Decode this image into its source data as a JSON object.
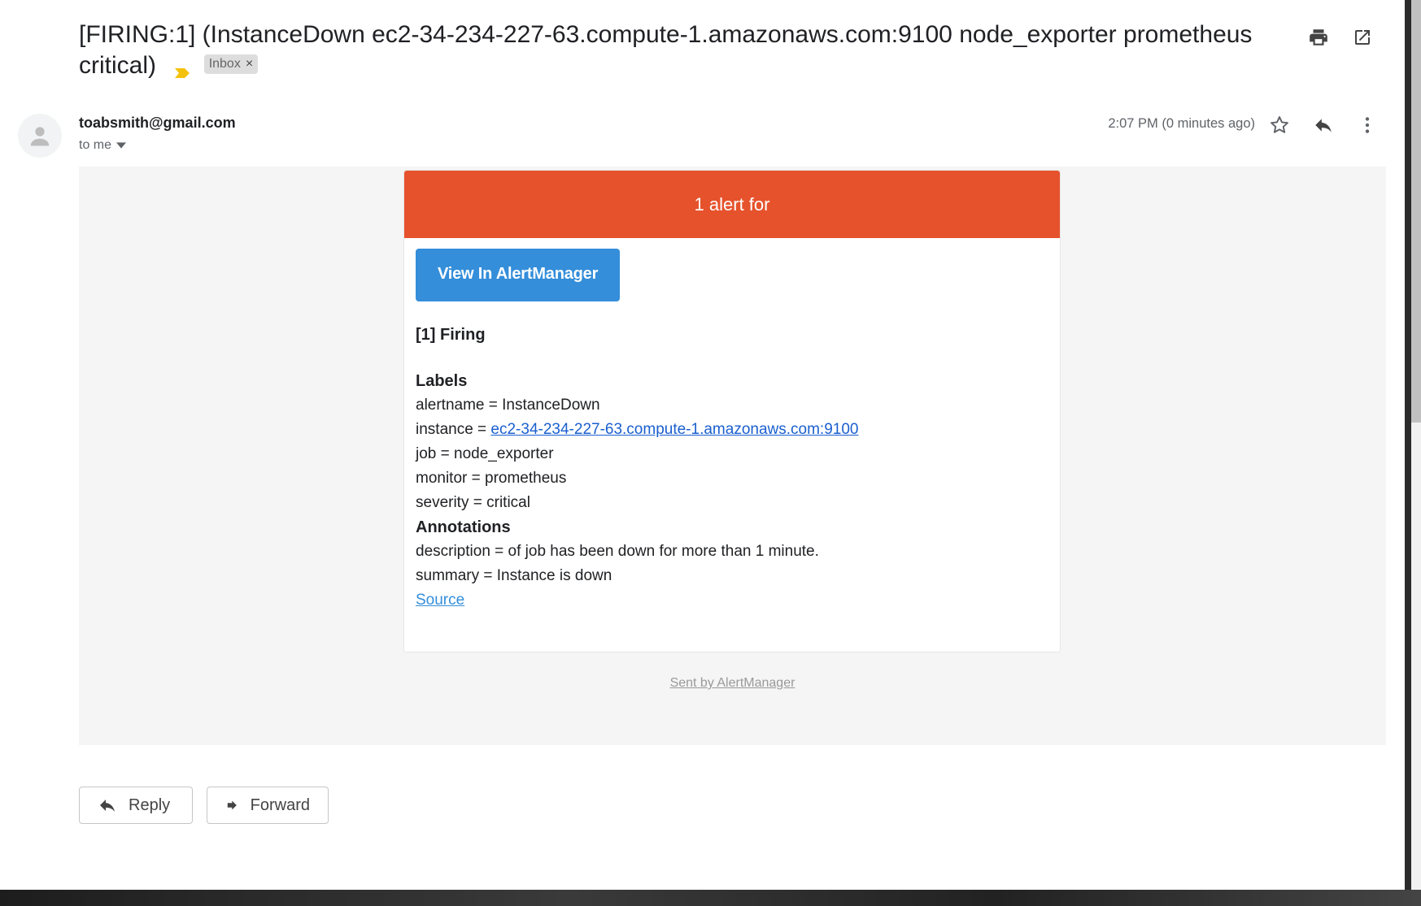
{
  "subject": {
    "text": "[FIRING:1] (InstanceDown ec2-34-234-227-63.compute-1.amazonaws.com:9100 node_exporter prometheus critical)",
    "label_chip": "Inbox",
    "label_chip_close": "×"
  },
  "message": {
    "sender": "toabsmith@gmail.com",
    "to": "to me",
    "time": "2:07 PM (0 minutes ago)"
  },
  "email": {
    "header": "1 alert for",
    "button": "View In AlertManager",
    "firing": "[1] Firing",
    "labels_title": "Labels",
    "labels": {
      "alertname": "alertname = InstanceDown",
      "instance_prefix": "instance = ",
      "instance_link": "ec2-34-234-227-63.compute-1.amazonaws.com:9100",
      "job": "job = node_exporter",
      "monitor": "monitor = prometheus",
      "severity": "severity = critical"
    },
    "annotations_title": "Annotations",
    "annotations": {
      "description": "description = of job has been down for more than 1 minute.",
      "summary": "summary = Instance is down"
    },
    "source": "Source",
    "footer": "Sent by AlertManager"
  },
  "actions": {
    "reply": "Reply",
    "forward": "Forward"
  },
  "colors": {
    "alert_header": "#e6522c",
    "button": "#348eda",
    "importance_marker": "#f4c20d"
  },
  "icons": [
    "print-icon",
    "open-in-new-window-icon",
    "avatar-icon",
    "dropdown-icon",
    "star-icon",
    "reply-icon",
    "more-vert-icon",
    "importance-marker-icon",
    "forward-icon"
  ]
}
